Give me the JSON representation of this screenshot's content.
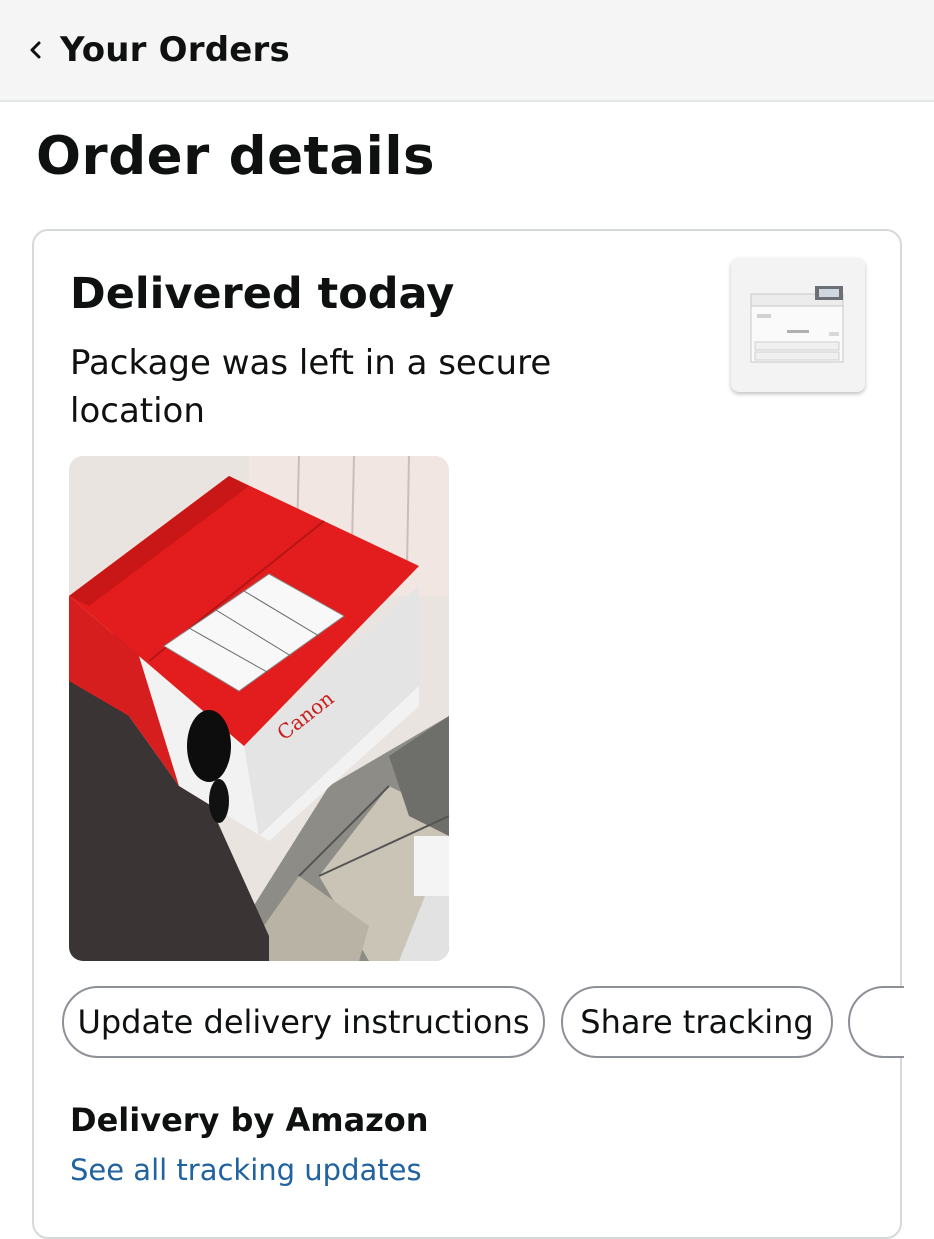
{
  "header": {
    "back_label": "Your Orders",
    "back_icon": "chevron-left-icon"
  },
  "page": {
    "title": "Order details"
  },
  "shipment": {
    "status": "Delivered today",
    "status_detail": "Package was left in a secure location",
    "product_image": "printer-product-thumbnail",
    "delivery_photo": "delivered-package-photo",
    "photo_box_brand_text": "Canon",
    "actions": [
      {
        "label": "Update delivery instructions"
      },
      {
        "label": "Share tracking"
      },
      {
        "label": ""
      }
    ],
    "carrier_heading": "Delivery by Amazon",
    "tracking_link": "See all tracking updates"
  },
  "colors": {
    "link": "#2162a1",
    "header_bg": "#f5f5f5",
    "border": "#d5d9d9",
    "text": "#0f1111"
  }
}
